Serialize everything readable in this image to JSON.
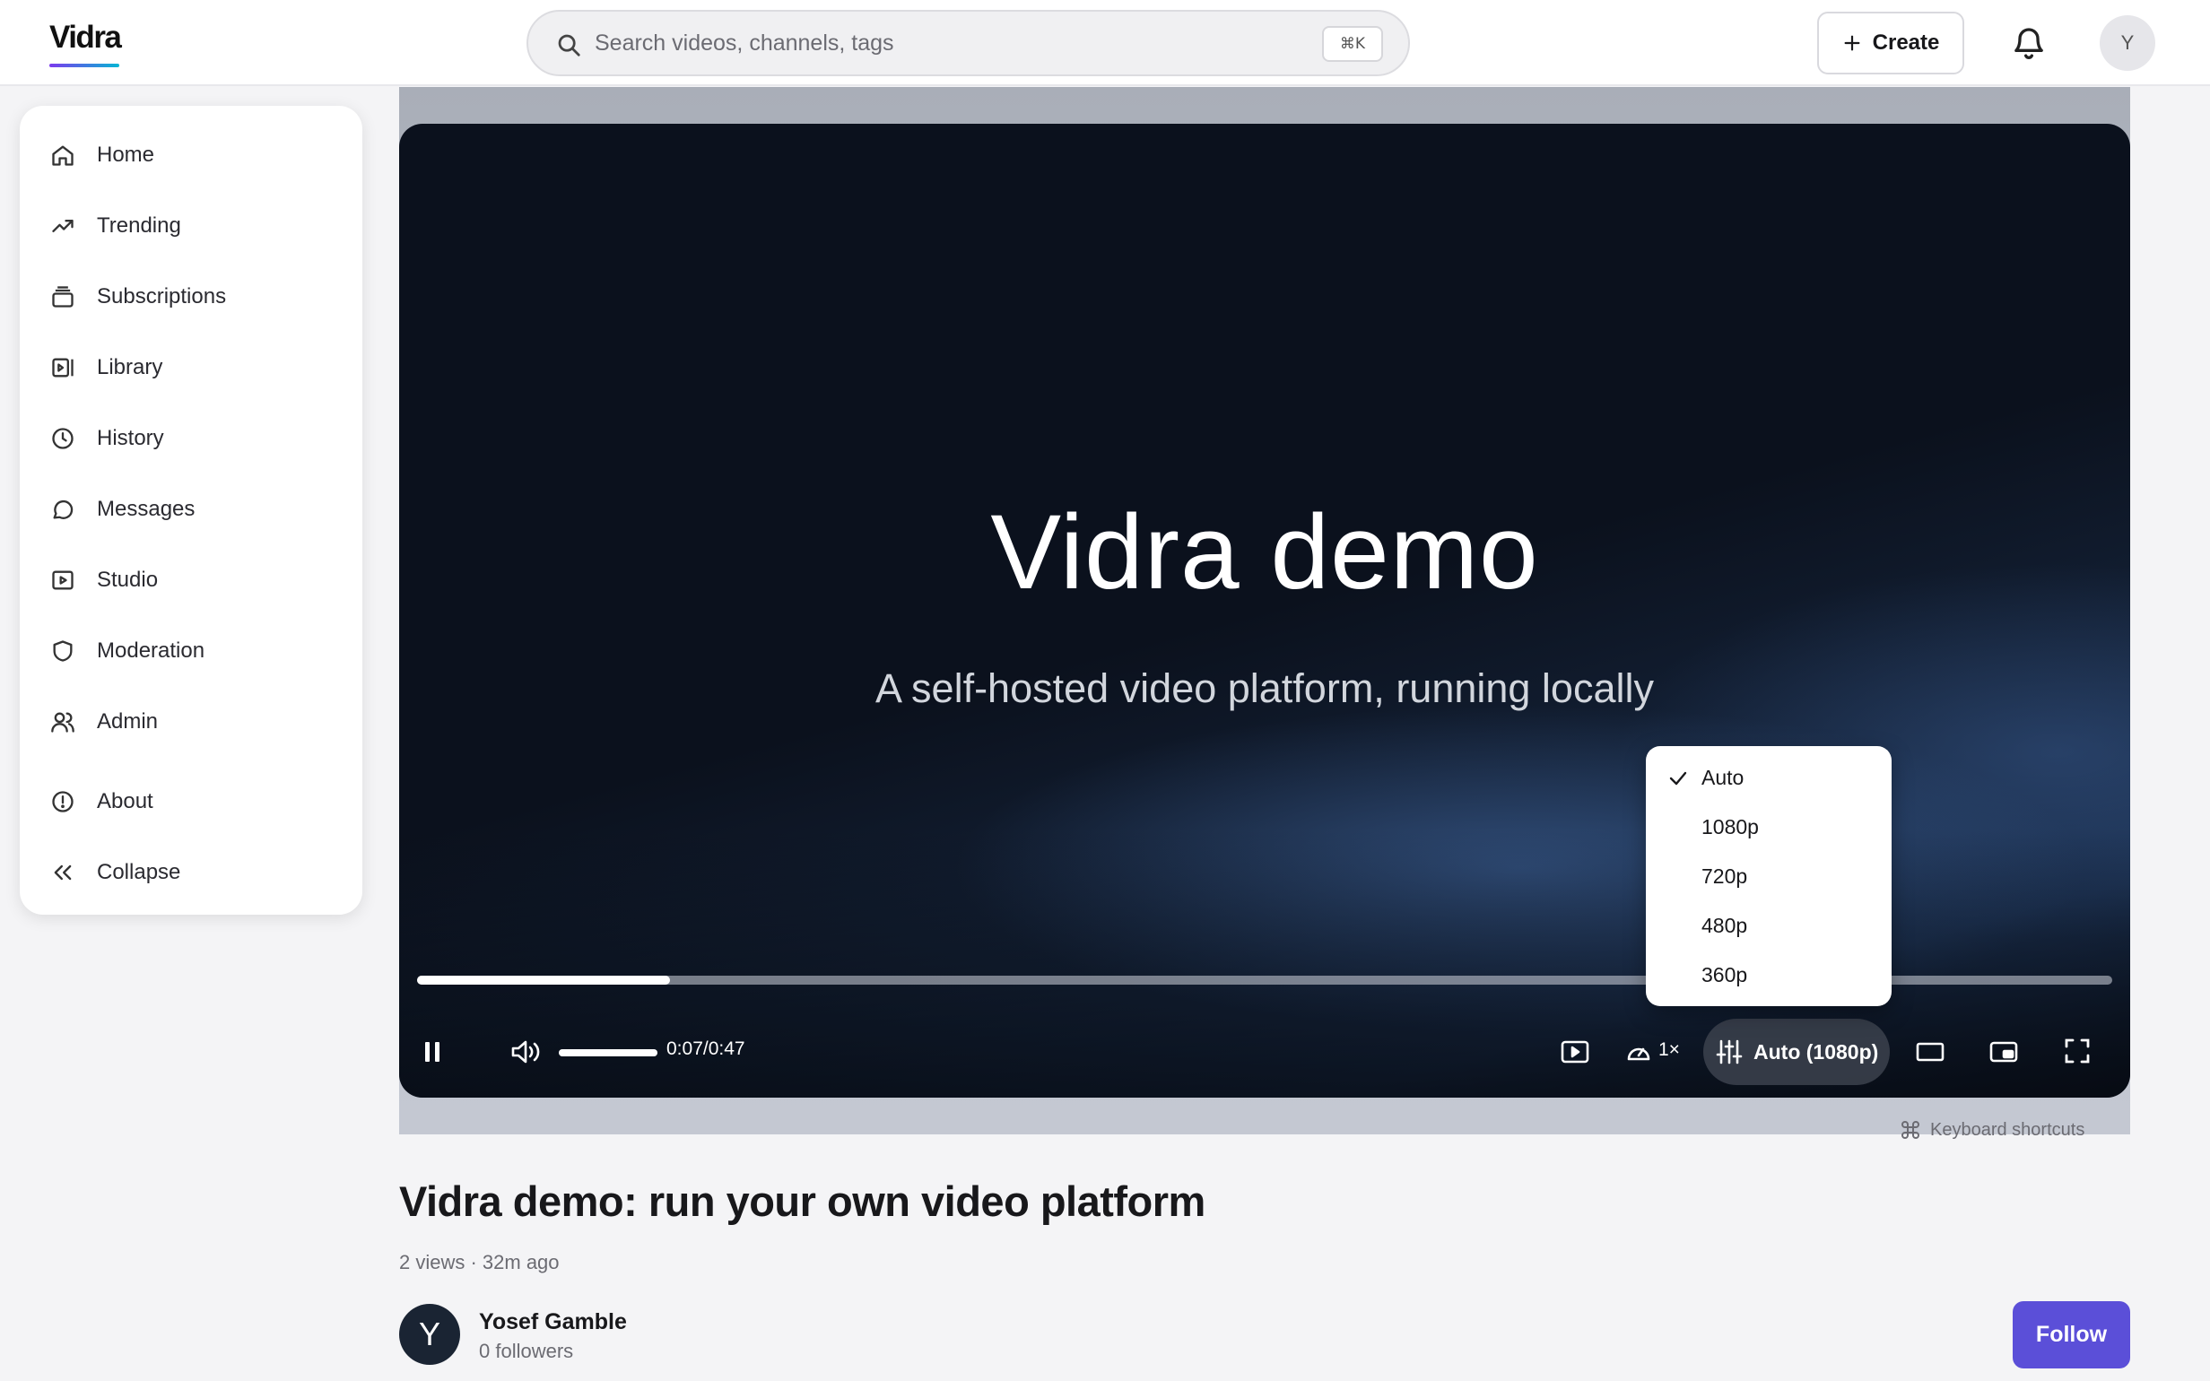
{
  "app": {
    "name": "Vidra"
  },
  "header": {
    "search_placeholder": "Search videos, channels, tags",
    "search_shortcut": "⌘K",
    "create_label": "Create",
    "avatar_initial": "Y"
  },
  "sidebar": {
    "items": [
      {
        "label": "Home",
        "icon": "home-icon"
      },
      {
        "label": "Trending",
        "icon": "trending-icon"
      },
      {
        "label": "Subscriptions",
        "icon": "subscriptions-icon"
      },
      {
        "label": "Library",
        "icon": "library-icon"
      },
      {
        "label": "History",
        "icon": "history-icon"
      },
      {
        "label": "Messages",
        "icon": "messages-icon"
      },
      {
        "label": "Studio",
        "icon": "studio-icon"
      },
      {
        "label": "Moderation",
        "icon": "moderation-icon"
      },
      {
        "label": "Admin",
        "icon": "admin-icon"
      },
      {
        "label": "About",
        "icon": "about-icon"
      },
      {
        "label": "Collapse",
        "icon": "collapse-icon"
      }
    ]
  },
  "player": {
    "frame_title": "Vidra demo",
    "frame_subtitle": "A self-hosted video platform, running locally",
    "progress_fraction": 0.149,
    "volume_fraction": 1.0,
    "time": "0:07/0:47",
    "speed": "1×",
    "quality_label": "Auto (1080p)",
    "quality_menu": [
      {
        "label": "Auto",
        "selected": true
      },
      {
        "label": "1080p",
        "selected": false
      },
      {
        "label": "720p",
        "selected": false
      },
      {
        "label": "480p",
        "selected": false
      },
      {
        "label": "360p",
        "selected": false
      }
    ],
    "keyboard_shortcuts_label": "Keyboard shortcuts"
  },
  "video": {
    "title": "Vidra demo: run your own video platform",
    "meta": "2 views · 32m ago"
  },
  "channel": {
    "avatar_initial": "Y",
    "name": "Yosef Gamble",
    "followers": "0 followers",
    "follow_label": "Follow"
  },
  "colors": {
    "accent": "#5b4fd8",
    "player_bg": "#0b111d"
  }
}
